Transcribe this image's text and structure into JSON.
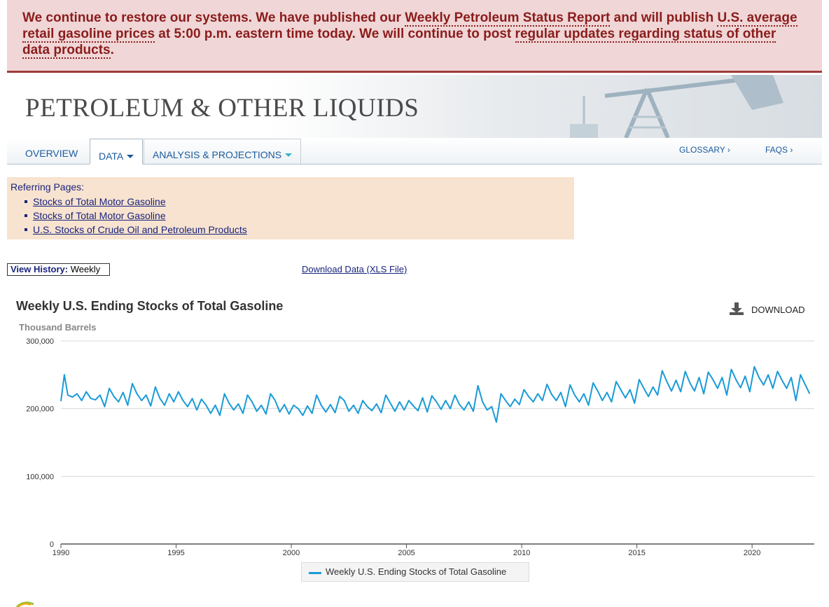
{
  "alert": {
    "part1": "We continue to restore our systems. We have published our ",
    "link1": "Weekly Petroleum Status Report",
    "part2": " and will publish ",
    "link2": "U.S. average retail gasoline prices",
    "part3": " at 5:00 p.m. eastern time today. We will continue to post ",
    "link3": "regular updates regarding status of other data products",
    "part4": "."
  },
  "banner": {
    "title": "PETROLEUM & OTHER LIQUIDS"
  },
  "nav": {
    "overview": "OVERVIEW",
    "data": "DATA",
    "analysis": "ANALYSIS & PROJECTIONS",
    "glossary": "GLOSSARY ›",
    "faqs": "FAQS ›"
  },
  "referring": {
    "label": "Referring Pages:",
    "items": [
      "Stocks of Total Motor Gasoline",
      "Stocks of Total Motor Gasoline",
      "U.S. Stocks of Crude Oil and Petroleum Products"
    ]
  },
  "toolbar": {
    "view_history_label": "View History:",
    "view_history_value": "Weekly",
    "download_data": "Download Data (XLS File)"
  },
  "chart_header": {
    "download_label": "DOWNLOAD"
  },
  "colors": {
    "series": "#1a9bd7",
    "alert_text": "#8b1c1c",
    "link": "#1a237e"
  },
  "chart_data": {
    "type": "line",
    "title": "Weekly U.S. Ending Stocks of Total Gasoline",
    "ylabel": "Thousand Barrels",
    "xlabel": "",
    "ylim": [
      0,
      300000
    ],
    "yticks": [
      0,
      100000,
      200000,
      300000
    ],
    "ytick_labels": [
      "0",
      "100,000",
      "200,000",
      "300,000"
    ],
    "xlim": [
      1990,
      2022.7
    ],
    "xticks": [
      1990,
      1995,
      2000,
      2005,
      2010,
      2015,
      2020
    ],
    "grid": true,
    "legend": "bottom-center",
    "series": [
      {
        "name": "Weekly U.S. Ending Stocks of Total Gasoline",
        "x": [
          1990.0,
          1990.15,
          1990.3,
          1990.5,
          1990.7,
          1990.9,
          1991.1,
          1991.3,
          1991.5,
          1991.7,
          1991.9,
          1992.1,
          1992.3,
          1992.5,
          1992.7,
          1992.9,
          1993.1,
          1993.3,
          1993.5,
          1993.7,
          1993.9,
          1994.1,
          1994.3,
          1994.5,
          1994.7,
          1994.9,
          1995.1,
          1995.3,
          1995.5,
          1995.7,
          1995.9,
          1996.1,
          1996.3,
          1996.5,
          1996.7,
          1996.9,
          1997.1,
          1997.3,
          1997.5,
          1997.7,
          1997.9,
          1998.1,
          1998.3,
          1998.5,
          1998.7,
          1998.9,
          1999.1,
          1999.3,
          1999.5,
          1999.7,
          1999.9,
          2000.1,
          2000.3,
          2000.5,
          2000.7,
          2000.9,
          2001.1,
          2001.3,
          2001.5,
          2001.7,
          2001.9,
          2002.1,
          2002.3,
          2002.5,
          2002.7,
          2002.9,
          2003.1,
          2003.3,
          2003.5,
          2003.7,
          2003.9,
          2004.1,
          2004.3,
          2004.5,
          2004.7,
          2004.9,
          2005.1,
          2005.3,
          2005.5,
          2005.7,
          2005.9,
          2006.1,
          2006.3,
          2006.5,
          2006.7,
          2006.9,
          2007.1,
          2007.3,
          2007.5,
          2007.7,
          2007.9,
          2008.1,
          2008.3,
          2008.5,
          2008.7,
          2008.9,
          2009.1,
          2009.3,
          2009.5,
          2009.7,
          2009.9,
          2010.1,
          2010.3,
          2010.5,
          2010.7,
          2010.9,
          2011.1,
          2011.3,
          2011.5,
          2011.7,
          2011.9,
          2012.1,
          2012.3,
          2012.5,
          2012.7,
          2012.9,
          2013.1,
          2013.3,
          2013.5,
          2013.7,
          2013.9,
          2014.1,
          2014.3,
          2014.5,
          2014.7,
          2014.9,
          2015.1,
          2015.3,
          2015.5,
          2015.7,
          2015.9,
          2016.1,
          2016.3,
          2016.5,
          2016.7,
          2016.9,
          2017.1,
          2017.3,
          2017.5,
          2017.7,
          2017.9,
          2018.1,
          2018.3,
          2018.5,
          2018.7,
          2018.9,
          2019.1,
          2019.3,
          2019.5,
          2019.7,
          2019.9,
          2020.1,
          2020.3,
          2020.5,
          2020.7,
          2020.9,
          2021.1,
          2021.3,
          2021.5,
          2021.7,
          2021.9,
          2022.1,
          2022.3,
          2022.5
        ],
        "values": [
          211000,
          250000,
          220000,
          217000,
          222000,
          212000,
          225000,
          215000,
          213000,
          220000,
          203000,
          230000,
          218000,
          210000,
          224000,
          205000,
          237000,
          222000,
          212000,
          220000,
          204000,
          232000,
          215000,
          205000,
          222000,
          210000,
          225000,
          212000,
          203000,
          215000,
          198000,
          214000,
          205000,
          193000,
          205000,
          190000,
          222000,
          208000,
          198000,
          207000,
          193000,
          220000,
          210000,
          196000,
          205000,
          192000,
          222000,
          212000,
          195000,
          206000,
          192000,
          205000,
          200000,
          190000,
          204000,
          193000,
          220000,
          205000,
          195000,
          206000,
          194000,
          218000,
          212000,
          196000,
          205000,
          193000,
          212000,
          203000,
          197000,
          207000,
          194000,
          220000,
          208000,
          196000,
          210000,
          198000,
          212000,
          204000,
          197000,
          216000,
          195000,
          219000,
          210000,
          199000,
          212000,
          200000,
          220000,
          206000,
          198000,
          210000,
          196000,
          234000,
          210000,
          198000,
          203000,
          180000,
          222000,
          212000,
          203000,
          214000,
          206000,
          228000,
          218000,
          210000,
          222000,
          212000,
          236000,
          221000,
          212000,
          224000,
          203000,
          235000,
          220000,
          210000,
          222000,
          205000,
          238000,
          226000,
          212000,
          224000,
          210000,
          240000,
          228000,
          216000,
          228000,
          208000,
          243000,
          230000,
          218000,
          232000,
          220000,
          256000,
          240000,
          226000,
          242000,
          225000,
          255000,
          238000,
          226000,
          246000,
          222000,
          254000,
          243000,
          230000,
          246000,
          220000,
          258000,
          243000,
          231000,
          248000,
          225000,
          262000,
          246000,
          235000,
          250000,
          230000,
          255000,
          242000,
          230000,
          246000,
          212000,
          250000,
          236000,
          222000
        ]
      }
    ]
  }
}
